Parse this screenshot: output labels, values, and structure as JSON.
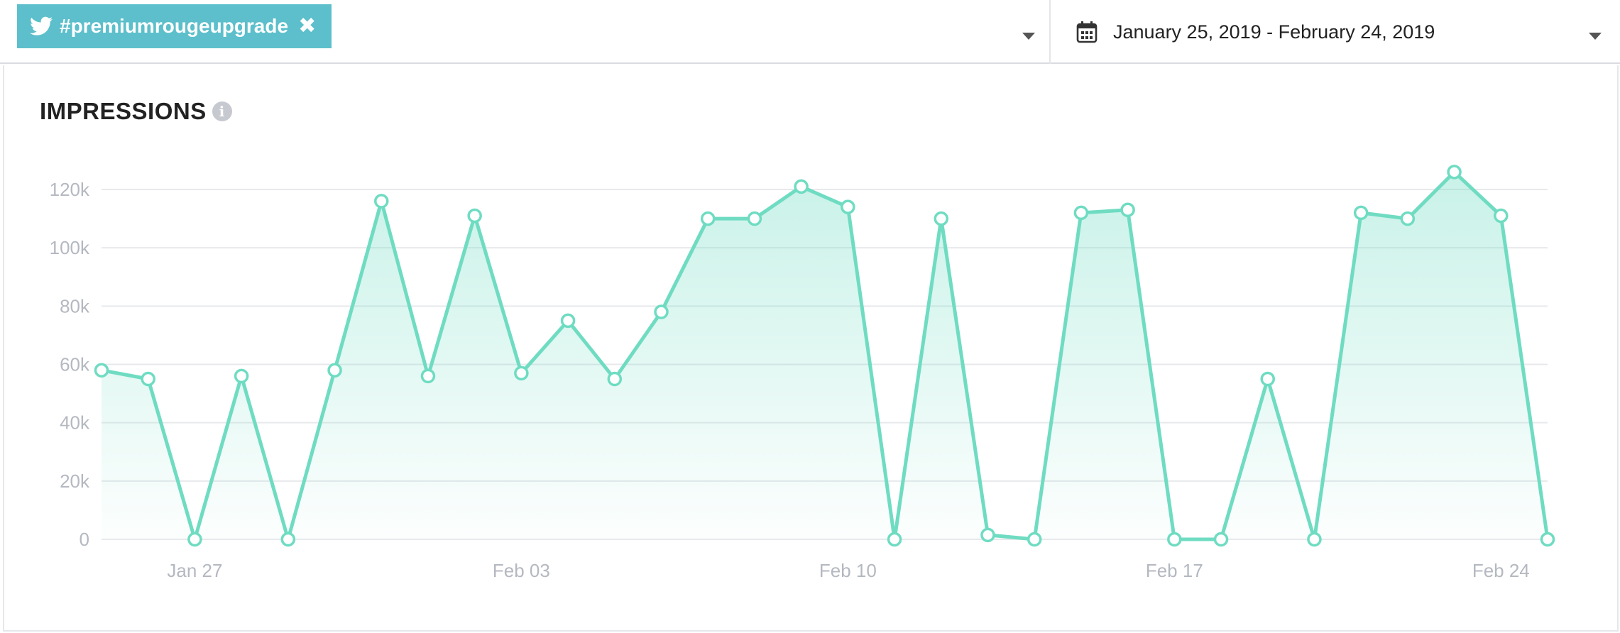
{
  "filter": {
    "hashtag": "#premiumrougeupgrade",
    "remove_glyph": "✖",
    "icon": "twitter-bird-icon",
    "tag_color": "#5cbfcb"
  },
  "date_range": {
    "label": "January 25, 2019 - February 24, 2019",
    "icon": "calendar-icon"
  },
  "card": {
    "title": "IMPRESSIONS",
    "info_glyph": "i"
  },
  "chart_data": {
    "type": "area",
    "title": "IMPRESSIONS",
    "xlabel": "",
    "ylabel": "",
    "color": "#6fdcc2",
    "grid": true,
    "ylim": [
      0,
      120000
    ],
    "y_ticks": [
      {
        "value": 0,
        "label": "0"
      },
      {
        "value": 20000,
        "label": "20k"
      },
      {
        "value": 40000,
        "label": "40k"
      },
      {
        "value": 60000,
        "label": "60k"
      },
      {
        "value": 80000,
        "label": "80k"
      },
      {
        "value": 100000,
        "label": "100k"
      },
      {
        "value": 120000,
        "label": "120k"
      }
    ],
    "x_ticks": [
      {
        "date": "2019-01-27",
        "label": "Jan 27"
      },
      {
        "date": "2019-02-03",
        "label": "Feb 03"
      },
      {
        "date": "2019-02-10",
        "label": "Feb 10"
      },
      {
        "date": "2019-02-17",
        "label": "Feb 17"
      },
      {
        "date": "2019-02-24",
        "label": "Feb 24"
      }
    ],
    "x": [
      "2019-01-25",
      "2019-01-26",
      "2019-01-27",
      "2019-01-28",
      "2019-01-29",
      "2019-01-30",
      "2019-01-31",
      "2019-02-01",
      "2019-02-02",
      "2019-02-03",
      "2019-02-04",
      "2019-02-05",
      "2019-02-06",
      "2019-02-07",
      "2019-02-08",
      "2019-02-09",
      "2019-02-10",
      "2019-02-11",
      "2019-02-12",
      "2019-02-13",
      "2019-02-14",
      "2019-02-15",
      "2019-02-16",
      "2019-02-17",
      "2019-02-18",
      "2019-02-19",
      "2019-02-20",
      "2019-02-21",
      "2019-02-22",
      "2019-02-23",
      "2019-02-24",
      "2019-02-25"
    ],
    "values": [
      58000,
      55000,
      0,
      56000,
      0,
      58000,
      116000,
      56000,
      111000,
      57000,
      75000,
      55000,
      78000,
      110000,
      110000,
      121000,
      114000,
      0,
      110000,
      1500,
      0,
      112000,
      113000,
      0,
      0,
      55000,
      0,
      112000,
      110000,
      126000,
      111000,
      0
    ]
  }
}
